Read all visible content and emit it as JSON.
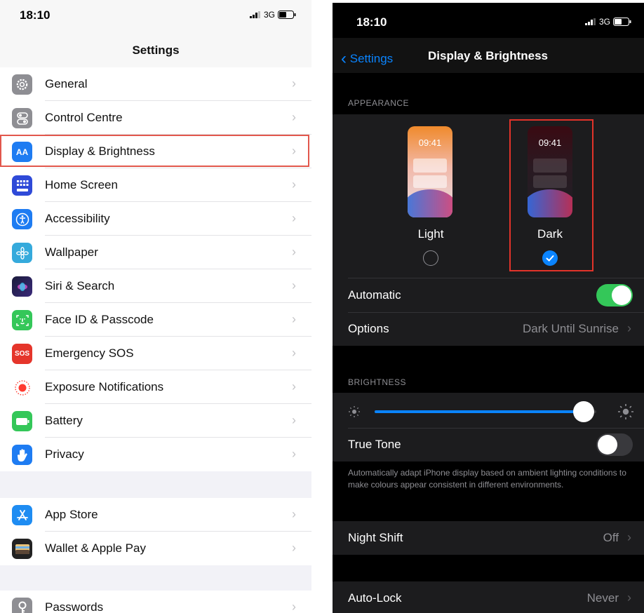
{
  "left": {
    "status": {
      "time": "18:10",
      "network": "3G"
    },
    "nav_title": "Settings",
    "groups": [
      {
        "items": [
          {
            "label": "General",
            "icon": "gear-icon",
            "color": "#8e8e93"
          },
          {
            "label": "Control Centre",
            "icon": "switches-icon",
            "color": "#8e8e93"
          },
          {
            "label": "Display & Brightness",
            "icon": "text-size-icon",
            "color": "#1e7cf2"
          },
          {
            "label": "Home Screen",
            "icon": "app-grid-icon",
            "color": "#2f4ad8"
          },
          {
            "label": "Accessibility",
            "icon": "accessibility-icon",
            "color": "#1e7cf2"
          },
          {
            "label": "Wallpaper",
            "icon": "flower-icon",
            "color": "#35aadc"
          },
          {
            "label": "Siri & Search",
            "icon": "siri-icon",
            "color": "#2b2b6e"
          },
          {
            "label": "Face ID & Passcode",
            "icon": "face-id-icon",
            "color": "#34c759"
          },
          {
            "label": "Emergency SOS",
            "icon": "sos-icon",
            "color": "#e5352b"
          },
          {
            "label": "Exposure Notifications",
            "icon": "exposure-icon",
            "color": "#ffffff"
          },
          {
            "label": "Battery",
            "icon": "battery-icon",
            "color": "#34c759"
          },
          {
            "label": "Privacy",
            "icon": "hand-icon",
            "color": "#1e7cf2"
          }
        ]
      },
      {
        "items": [
          {
            "label": "App Store",
            "icon": "app-store-icon",
            "color": "#1e8cf2"
          },
          {
            "label": "Wallet & Apple Pay",
            "icon": "wallet-icon",
            "color": "#222222"
          }
        ]
      },
      {
        "items": [
          {
            "label": "Passwords",
            "icon": "key-icon",
            "color": "#8e8e93"
          }
        ]
      }
    ]
  },
  "right": {
    "status": {
      "time": "18:10",
      "network": "3G"
    },
    "back_label": "Settings",
    "nav_title": "Display & Brightness",
    "appearance_header": "APPEARANCE",
    "light_option": {
      "preview_time": "09:41",
      "label": "Light",
      "selected": false
    },
    "dark_option": {
      "preview_time": "09:41",
      "label": "Dark",
      "selected": true
    },
    "automatic": {
      "label": "Automatic",
      "on": true
    },
    "options": {
      "label": "Options",
      "value": "Dark Until Sunrise"
    },
    "brightness_header": "BRIGHTNESS",
    "brightness_level": 0.99,
    "true_tone": {
      "label": "True Tone",
      "on": false
    },
    "true_tone_note": "Automatically adapt iPhone display based on ambient lighting conditions to make colours appear consistent in different environments.",
    "night_shift": {
      "label": "Night Shift",
      "value": "Off"
    },
    "auto_lock": {
      "label": "Auto-Lock",
      "value": "Never"
    }
  },
  "colors": {
    "accent": "#0a84ff",
    "switch_on": "#34c759",
    "highlight": "#e2574c"
  }
}
